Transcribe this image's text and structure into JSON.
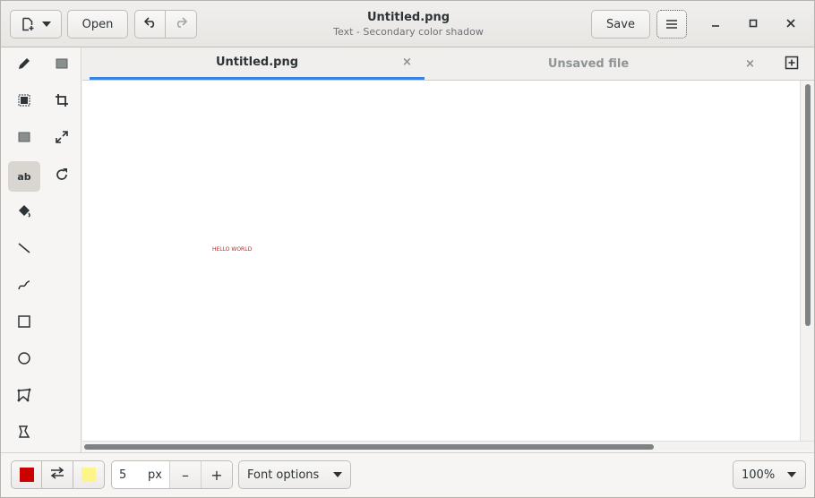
{
  "header": {
    "title": "Untitled.png",
    "subtitle": "Text - Secondary color shadow",
    "open_label": "Open",
    "save_label": "Save"
  },
  "tabs": [
    {
      "label": "Untitled.png",
      "close": "×",
      "active": true
    },
    {
      "label": "Unsaved file",
      "close": "×",
      "active": false
    }
  ],
  "tools": {
    "active": "text",
    "text_icon_label": "ab"
  },
  "canvas": {
    "text": "HELLO WORLD",
    "text_color": "#cc1f1f"
  },
  "bottom": {
    "primary_color": "#cc0000",
    "secondary_color": "#fdf58a",
    "size_value": "5",
    "size_unit": "px",
    "minus": "–",
    "plus": "+",
    "options_label": "Font options",
    "zoom_label": "100%"
  },
  "colors": {
    "accent": "#3584e4"
  }
}
